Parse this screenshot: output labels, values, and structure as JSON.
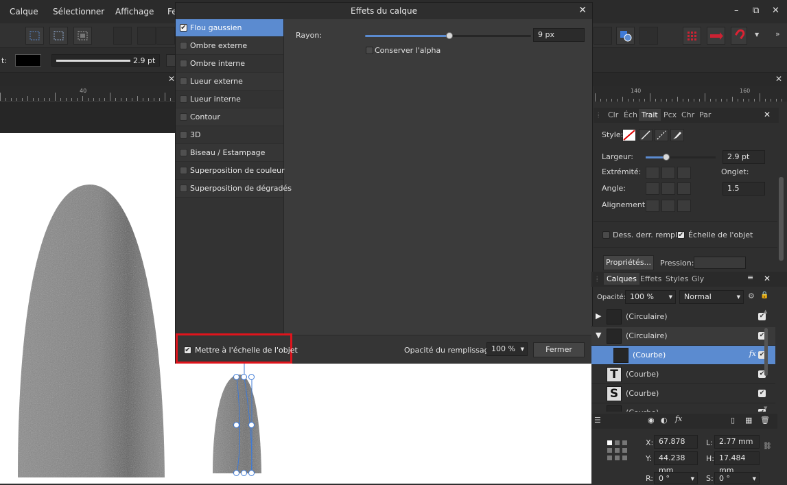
{
  "menu": {
    "items": [
      "Calque",
      "Sélectionner",
      "Affichage",
      "Fe"
    ],
    "window_controls": [
      "–",
      "⧉",
      "✕"
    ]
  },
  "contextbar": {
    "stroke_label": "t:",
    "stroke_width": "2.9 pt"
  },
  "ruler": {
    "labels_left": [
      "40"
    ],
    "labels_right": [
      "140",
      "160"
    ]
  },
  "dialog": {
    "title": "Effets du calque",
    "effects": [
      {
        "label": "Flou gaussien",
        "checked": true,
        "selected": true
      },
      {
        "label": "Ombre externe",
        "checked": false,
        "selected": false
      },
      {
        "label": "Ombre interne",
        "checked": false,
        "selected": false
      },
      {
        "label": "Lueur externe",
        "checked": false,
        "selected": false
      },
      {
        "label": "Lueur interne",
        "checked": false,
        "selected": false
      },
      {
        "label": "Contour",
        "checked": false,
        "selected": false
      },
      {
        "label": "3D",
        "checked": false,
        "selected": false
      },
      {
        "label": "Biseau / Estampage",
        "checked": false,
        "selected": false
      },
      {
        "label": "Superposition de couleur",
        "checked": false,
        "selected": false
      },
      {
        "label": "Superposition de dégradés",
        "checked": false,
        "selected": false
      }
    ],
    "radius_label": "Rayon:",
    "radius_value": "9 px",
    "radius_fraction": 0.51,
    "preserve_alpha_label": "Conserver l'alpha",
    "scale_with_object_label": "Mettre à l'échelle de l'objet",
    "fill_opacity_label": "Opacité du remplissage:",
    "fill_opacity_value": "100 %",
    "close_label": "Fermer"
  },
  "stroke_panel": {
    "tabs": [
      "Clr",
      "Éch",
      "Trait",
      "Pcx",
      "Chr",
      "Par"
    ],
    "active_tab": "Trait",
    "style_label": "Style:",
    "width_label": "Largeur:",
    "width_value": "2.9 pt",
    "cap_label": "Extrémité:",
    "miter_label": "Onglet:",
    "join_label": "Angle:",
    "miter_value": "1.5",
    "align_label": "Alignement:",
    "draw_behind_label": "Dess. derr. rempl",
    "scale_with_object_label": "Échelle de l'objet",
    "properties_button": "Propriétés...",
    "pressure_label": "Pression:"
  },
  "layers_panel": {
    "tabs": [
      "Calques",
      "Effets",
      "Styles",
      "Gly"
    ],
    "active_tab": "Calques",
    "opacity_label": "Opacité:",
    "opacity_value": "100 %",
    "blend_mode": "Normal",
    "layers": [
      {
        "name": "(Circulaire)",
        "expander": "▶",
        "selected": false,
        "fx": ""
      },
      {
        "name": "(Circulaire)",
        "expander": "▼",
        "selected": false,
        "fx": ""
      },
      {
        "name": "(Courbe)",
        "expander": "",
        "selected": true,
        "fx": "fx"
      },
      {
        "name": "(Courbe)",
        "expander": "",
        "selected": false,
        "fx": "",
        "thumb_letter": "T"
      },
      {
        "name": "(Courbe)",
        "expander": "",
        "selected": false,
        "fx": "",
        "thumb_letter": "S"
      },
      {
        "name": "(Courbe)",
        "expander": "",
        "selected": false,
        "fx": ""
      }
    ]
  },
  "transform_panel": {
    "x_label": "X:",
    "x_value": "67.878 mm",
    "y_label": "Y:",
    "y_value": "44.238 mm",
    "w_label": "L:",
    "w_value": "2.77 mm",
    "h_label": "H:",
    "h_value": "17.484 mm",
    "r_label": "R:",
    "r_value": "0 °",
    "s_label": "S:",
    "s_value": "0 °"
  },
  "colors": {
    "accent": "#5b8bd0",
    "highlight_box": "#e0141c"
  }
}
